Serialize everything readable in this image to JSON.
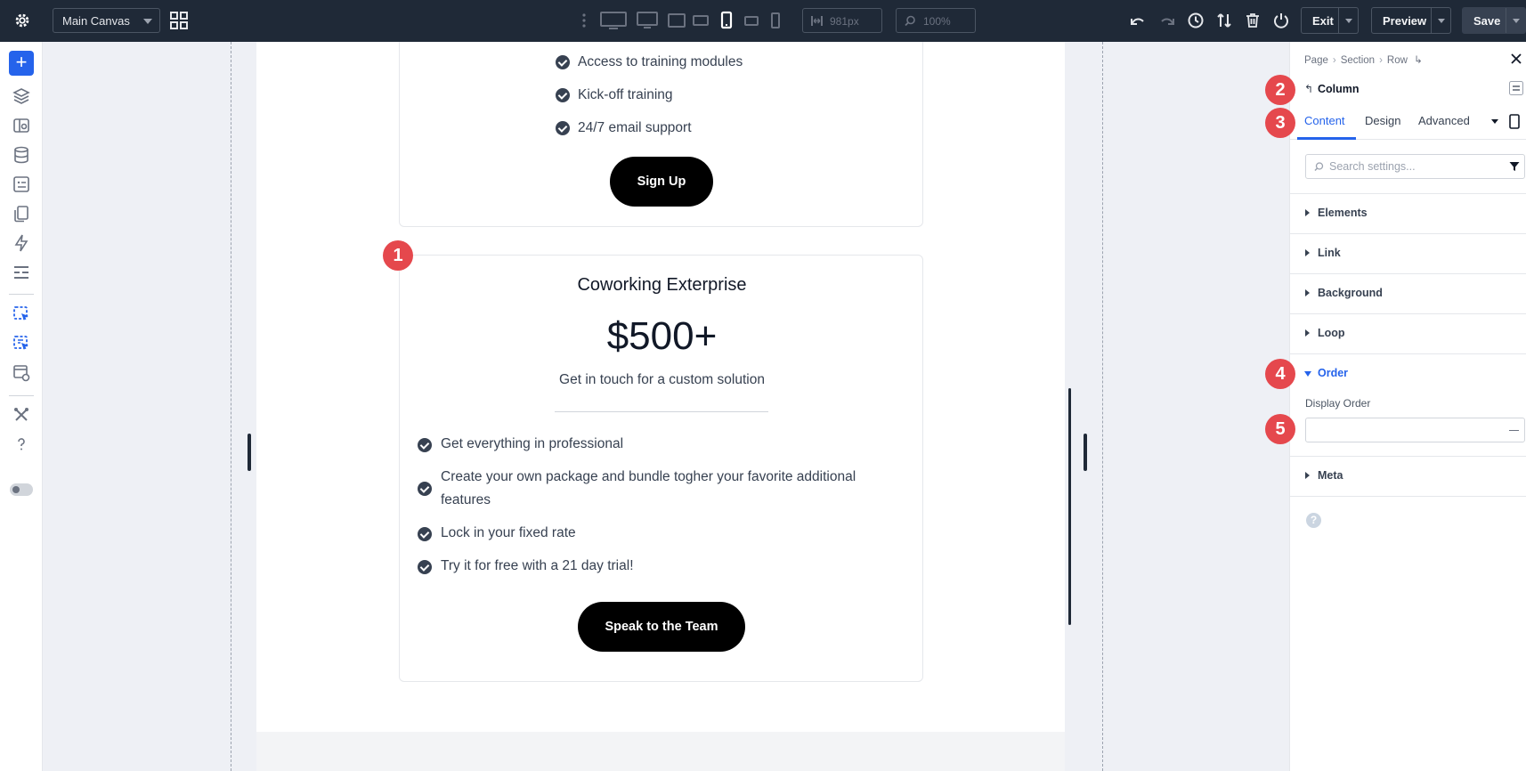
{
  "topbar": {
    "canvas_select": "Main Canvas",
    "width_value": "981px",
    "zoom_value": "100%",
    "exit_label": "Exit",
    "preview_label": "Preview",
    "save_label": "Save"
  },
  "canvas": {
    "top_card": {
      "features": [
        "Access to training modules",
        "Kick-off training",
        "24/7 email support"
      ],
      "button": "Sign Up"
    },
    "main_card": {
      "title": "Coworking Exterprise",
      "price": "$500+",
      "subtitle": "Get in touch for a custom solution",
      "features": [
        "Get everything in professional",
        "Create your own package and bundle togher your favorite additional",
        "features",
        "Lock in your fixed rate",
        "Try it for free with a 21 day trial!"
      ],
      "button": "Speak to the Team"
    }
  },
  "badges": [
    "1",
    "2",
    "3",
    "4",
    "5"
  ],
  "panel": {
    "breadcrumb": [
      "Page",
      "Section",
      "Row"
    ],
    "title": "Column",
    "tabs": [
      "Content",
      "Design",
      "Advanced"
    ],
    "search_placeholder": "Search settings...",
    "groups": [
      "Elements",
      "Link",
      "Background",
      "Loop",
      "Order",
      "Meta"
    ],
    "display_order_label": "Display Order",
    "display_order_value": "",
    "help": "?"
  },
  "colors": {
    "accent": "#2563eb",
    "badge": "#e5484d",
    "topbar": "#1f2937"
  }
}
